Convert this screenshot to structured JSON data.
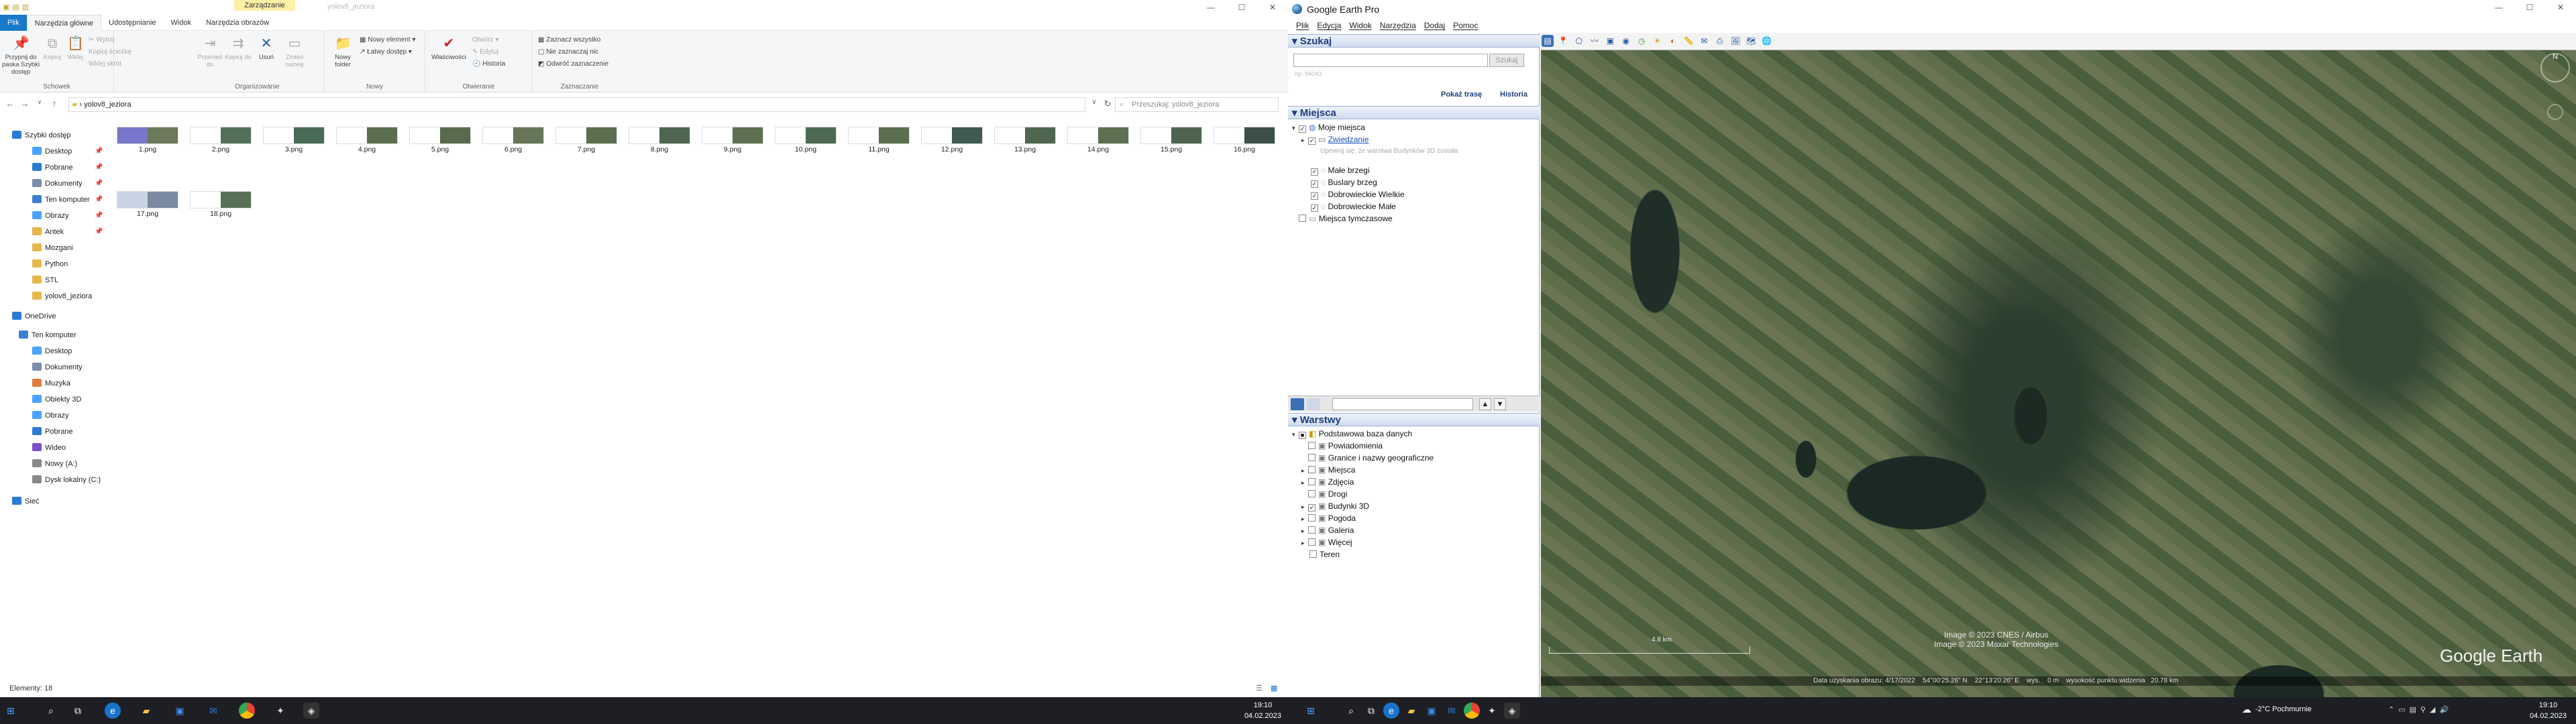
{
  "explorer": {
    "title_context_tab": "Zarządzanie",
    "title_name": "yolov8_jeziora",
    "window_controls": [
      "—",
      "☐",
      "✕"
    ],
    "tabs": [
      "Plik",
      "Narzędzia główne",
      "Udostępnianie",
      "Widok",
      "Narzędzia obrazów"
    ],
    "ribbon": {
      "clipboard": {
        "pin": "Przypnij do paska Szybki dostęp",
        "copy": "Kopiuj",
        "paste": "Wklej",
        "cut": "Wytnij",
        "copy_path": "Kopiuj ścieżkę",
        "paste_shortcut": "Wklej skrót",
        "group": "Schowek"
      },
      "organize": {
        "move_to": "Przenieś do",
        "copy_to": "Kopiuj do",
        "delete": "Usuń",
        "rename": "Zmień nazwę",
        "group": "Organizowanie"
      },
      "new": {
        "new_folder": "Nowy folder",
        "new_item": "Nowy element",
        "easy_access": "Łatwy dostęp",
        "group": "Nowy"
      },
      "open": {
        "properties": "Właściwości",
        "open": "Otwórz",
        "edit": "Edytuj",
        "history": "Historia",
        "group": "Otwieranie"
      },
      "select": {
        "select_all": "Zaznacz wszystko",
        "select_none": "Nie zaznaczaj nic",
        "invert": "Odwróć zaznaczenie",
        "group": "Zaznaczanie"
      }
    },
    "address": "yolov8_jeziora",
    "search_placeholder": "Przeszukaj: yolov8_jeziora",
    "nav": [
      {
        "label": "Szybki dostęp",
        "pinned": false
      },
      {
        "label": "Desktop",
        "pinned": true
      },
      {
        "label": "Pobrane",
        "pinned": true
      },
      {
        "label": "Dokumenty",
        "pinned": true
      },
      {
        "label": "Ten komputer",
        "pinned": true
      },
      {
        "label": "Obrazy",
        "pinned": true
      },
      {
        "label": "Antek",
        "pinned": true
      },
      {
        "label": "Mozgani",
        "pinned": false
      },
      {
        "label": "Python",
        "pinned": false
      },
      {
        "label": "STL",
        "pinned": false
      },
      {
        "label": "yolov8_jeziora",
        "pinned": false
      },
      {
        "label": "OneDrive",
        "pinned": false
      },
      {
        "label": "Ten komputer",
        "pinned": false
      },
      {
        "label": "Desktop",
        "pinned": false
      },
      {
        "label": "Dokumenty",
        "pinned": false
      },
      {
        "label": "Muzyka",
        "pinned": false
      },
      {
        "label": "Obiekty 3D",
        "pinned": false
      },
      {
        "label": "Obrazy",
        "pinned": false
      },
      {
        "label": "Pobrane",
        "pinned": false
      },
      {
        "label": "Wideo",
        "pinned": false
      },
      {
        "label": "Nowy (A:)",
        "pinned": false
      },
      {
        "label": "Dysk lokalny (C:)",
        "pinned": false
      },
      {
        "label": "Sieć",
        "pinned": false
      }
    ],
    "files": [
      "1.png",
      "2.png",
      "3.png",
      "4.png",
      "5.png",
      "6.png",
      "7.png",
      "8.png",
      "9.png",
      "10.png",
      "11.png",
      "12.png",
      "13.png",
      "14.png",
      "15.png",
      "16.png",
      "17.png",
      "18.png"
    ],
    "status": "Elementy: 18"
  },
  "earth": {
    "title": "Google Earth Pro",
    "menu": [
      "Plik",
      "Edycja",
      "Widok",
      "Narzędzia",
      "Dodaj",
      "Pomoc"
    ],
    "search": {
      "header": "Szukaj",
      "button": "Szukaj",
      "example": "np. 94043",
      "route_link": "Pokaż trasę",
      "history_link": "Historia"
    },
    "places": {
      "header": "Miejsca",
      "my_places": "Moje miejsca",
      "tour": "Zwiedzanie",
      "tour_hint": "Upewnij się, że warstwa Budynków 3D została",
      "items": [
        "Małe brzegi",
        "Buslary brzeg",
        "Dobrowieckie Wielkie",
        "Dobrowieckie Małe"
      ],
      "temporary": "Miejsca tymczasowe"
    },
    "layers": {
      "header": "Warstwy",
      "primary": "Podstawowa baza danych",
      "items": [
        "Powiadomienia",
        "Granice i nazwy geograficzne",
        "Miejsca",
        "Zdjęcia",
        "Drogi",
        "Budynki 3D",
        "Pogoda",
        "Galeria",
        "Więcej",
        "Teren"
      ]
    },
    "map": {
      "copyright_1": "Image © 2023 CNES / Airbus",
      "copyright_2": "Image © 2023 Maxar Technologies",
      "brand": "Google Earth",
      "scale": "4.8 km",
      "status": "Data uzyskania obrazu: 4/17/2022    54°00'25.26\" N    22°13'20.26\" E    wys.    0 m    wysokość punktu widzenia   20.78 km"
    }
  },
  "taskbar_left": {
    "time": "19:10",
    "date": "04.02.2023"
  },
  "taskbar_right": {
    "weather": "-2°C  Pochmurnie",
    "time": "19:10",
    "date": "04.02.2023"
  }
}
